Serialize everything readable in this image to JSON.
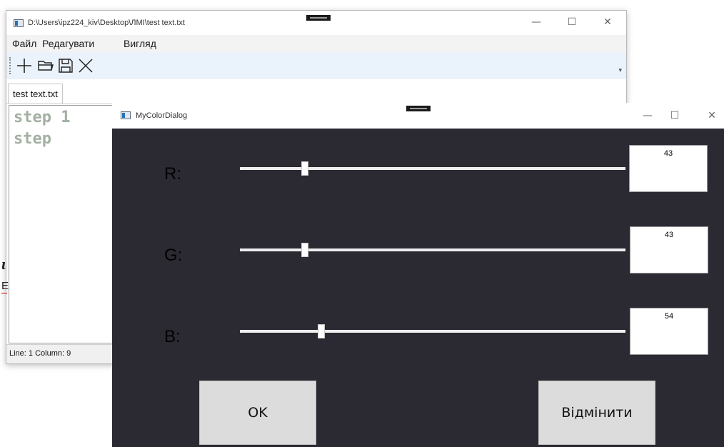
{
  "editor": {
    "title": "D:\\Users\\ipz224_kiv\\Desktop\\ЛМІ\\test text.txt",
    "controls": {
      "minimize": "—",
      "maximize": "☐",
      "close": "✕"
    },
    "menu": [
      "Файл",
      "Редагувати",
      "Вигляд"
    ],
    "toolbar_icons": [
      "new-icon",
      "open-folder-icon",
      "save-icon",
      "close-icon"
    ],
    "toolbar_overflow": "▾",
    "tab_label": "test text.txt",
    "code_lines": [
      "step 1",
      "step"
    ],
    "status": "Line:  1  Column:  9"
  },
  "background_fragments": {
    "italic_glyph": "ɩ",
    "text_glyph": "Е"
  },
  "dialog": {
    "title": "MyColorDialog",
    "controls": {
      "minimize": "—",
      "maximize": "☐",
      "close": "✕"
    },
    "background_color": "#2b2a33",
    "channels": [
      {
        "label": "R:",
        "value": "43",
        "level": 43
      },
      {
        "label": "G:",
        "value": "43",
        "level": 43
      },
      {
        "label": "B:",
        "value": "54",
        "level": 54
      }
    ],
    "slider_max": 255,
    "ok_label": "OK",
    "cancel_label": "Відмінити"
  }
}
